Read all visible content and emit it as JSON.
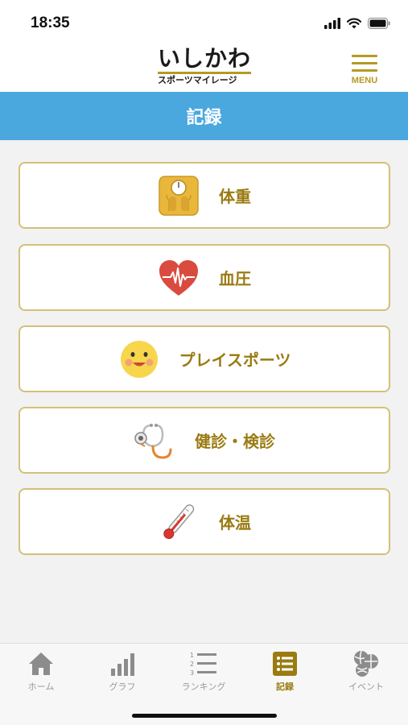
{
  "status_bar": {
    "time": "18:35",
    "icons": [
      "cellular-signal-icon",
      "wifi-icon",
      "battery-icon"
    ]
  },
  "header": {
    "logo_main": "いしかわ",
    "logo_sub": "スポーツマイレージ",
    "menu_label": "MENU",
    "menu_icon": "hamburger-menu-icon"
  },
  "page": {
    "title": "記録"
  },
  "records": [
    {
      "label": "体重",
      "icon": "weight-scale-icon"
    },
    {
      "label": "血圧",
      "icon": "heart-pulse-icon"
    },
    {
      "label": "プレイスポーツ",
      "icon": "smiley-face-icon"
    },
    {
      "label": "健診・検診",
      "icon": "stethoscope-icon"
    },
    {
      "label": "体温",
      "icon": "thermometer-icon"
    }
  ],
  "tabs": [
    {
      "label": "ホーム",
      "icon": "home-icon",
      "active": false
    },
    {
      "label": "グラフ",
      "icon": "bar-graph-icon",
      "active": false
    },
    {
      "label": "ランキング",
      "icon": "ranking-list-icon",
      "active": false
    },
    {
      "label": "記録",
      "icon": "record-list-icon",
      "active": true
    },
    {
      "label": "イベント",
      "icon": "event-balls-icon",
      "active": false
    }
  ],
  "colors": {
    "accent_gold": "#b59a22",
    "label_gold": "#9a7b12",
    "title_bar_blue": "#4aa8df",
    "button_border": "#d4c07a",
    "inactive_tab": "#999999"
  }
}
